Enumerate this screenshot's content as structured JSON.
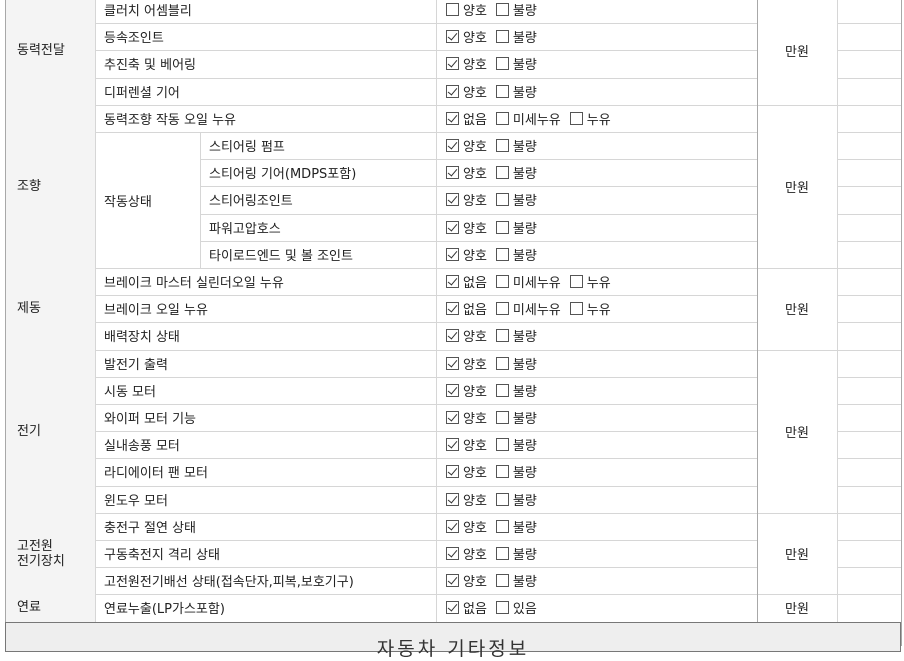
{
  "sections": [
    {
      "category": "동력전달",
      "cost_unit": "만원",
      "rows": [
        {
          "item": "클러치 어셈블리",
          "options": [
            {
              "label": "양호",
              "checked": false
            },
            {
              "label": "불량",
              "checked": false
            }
          ]
        },
        {
          "item": "등속조인트",
          "options": [
            {
              "label": "양호",
              "checked": true
            },
            {
              "label": "불량",
              "checked": false
            }
          ]
        },
        {
          "item": "추진축 및 베어링",
          "options": [
            {
              "label": "양호",
              "checked": true
            },
            {
              "label": "불량",
              "checked": false
            }
          ]
        },
        {
          "item": "디퍼렌셜 기어",
          "options": [
            {
              "label": "양호",
              "checked": true
            },
            {
              "label": "불량",
              "checked": false
            }
          ]
        }
      ]
    },
    {
      "category": "조향",
      "cost_unit": "만원",
      "rows": [
        {
          "item": "동력조향 작동 오일 누유",
          "options": [
            {
              "label": "없음",
              "checked": true
            },
            {
              "label": "미세누유",
              "checked": false
            },
            {
              "label": "누유",
              "checked": false
            }
          ]
        },
        {
          "item": "작동상태",
          "sub": "스티어링 펌프",
          "options": [
            {
              "label": "양호",
              "checked": true
            },
            {
              "label": "불량",
              "checked": false
            }
          ]
        },
        {
          "sub": "스티어링 기어(MDPS포함)",
          "options": [
            {
              "label": "양호",
              "checked": true
            },
            {
              "label": "불량",
              "checked": false
            }
          ]
        },
        {
          "sub": "스티어링조인트",
          "options": [
            {
              "label": "양호",
              "checked": true
            },
            {
              "label": "불량",
              "checked": false
            }
          ]
        },
        {
          "sub": "파워고압호스",
          "options": [
            {
              "label": "양호",
              "checked": true
            },
            {
              "label": "불량",
              "checked": false
            }
          ]
        },
        {
          "sub": "타이로드엔드 및 볼 조인트",
          "options": [
            {
              "label": "양호",
              "checked": true
            },
            {
              "label": "불량",
              "checked": false
            }
          ]
        }
      ]
    },
    {
      "category": "제동",
      "cost_unit": "만원",
      "rows": [
        {
          "item": "브레이크 마스터 실린더오일 누유",
          "options": [
            {
              "label": "없음",
              "checked": true
            },
            {
              "label": "미세누유",
              "checked": false
            },
            {
              "label": "누유",
              "checked": false
            }
          ]
        },
        {
          "item": "브레이크 오일 누유",
          "options": [
            {
              "label": "없음",
              "checked": true
            },
            {
              "label": "미세누유",
              "checked": false
            },
            {
              "label": "누유",
              "checked": false
            }
          ]
        },
        {
          "item": "배력장치 상태",
          "options": [
            {
              "label": "양호",
              "checked": true
            },
            {
              "label": "불량",
              "checked": false
            }
          ]
        }
      ]
    },
    {
      "category": "전기",
      "cost_unit": "만원",
      "rows": [
        {
          "item": "발전기 출력",
          "options": [
            {
              "label": "양호",
              "checked": true
            },
            {
              "label": "불량",
              "checked": false
            }
          ]
        },
        {
          "item": "시동 모터",
          "options": [
            {
              "label": "양호",
              "checked": true
            },
            {
              "label": "불량",
              "checked": false
            }
          ]
        },
        {
          "item": "와이퍼 모터 기능",
          "options": [
            {
              "label": "양호",
              "checked": true
            },
            {
              "label": "불량",
              "checked": false
            }
          ]
        },
        {
          "item": "실내송풍 모터",
          "options": [
            {
              "label": "양호",
              "checked": true
            },
            {
              "label": "불량",
              "checked": false
            }
          ]
        },
        {
          "item": "라디에이터 팬 모터",
          "options": [
            {
              "label": "양호",
              "checked": true
            },
            {
              "label": "불량",
              "checked": false
            }
          ]
        },
        {
          "item": "윈도우 모터",
          "options": [
            {
              "label": "양호",
              "checked": true
            },
            {
              "label": "불량",
              "checked": false
            }
          ]
        }
      ]
    },
    {
      "category": "고전원\n전기장치",
      "cost_unit": "만원",
      "rows": [
        {
          "item": "충전구 절연 상태",
          "options": [
            {
              "label": "양호",
              "checked": true
            },
            {
              "label": "불량",
              "checked": false
            }
          ]
        },
        {
          "item": "구동축전지 격리 상태",
          "options": [
            {
              "label": "양호",
              "checked": true
            },
            {
              "label": "불량",
              "checked": false
            }
          ]
        },
        {
          "item": "고전원전기배선 상태(접속단자,피복,보호기구)",
          "options": [
            {
              "label": "양호",
              "checked": true
            },
            {
              "label": "불량",
              "checked": false
            }
          ]
        }
      ]
    },
    {
      "category": "연료",
      "cost_unit": "만원",
      "rows": [
        {
          "item": "연료누출(LP가스포함)",
          "options": [
            {
              "label": "없음",
              "checked": true
            },
            {
              "label": "있음",
              "checked": false
            }
          ]
        }
      ]
    }
  ],
  "footer_title": "자동차 기타정보"
}
